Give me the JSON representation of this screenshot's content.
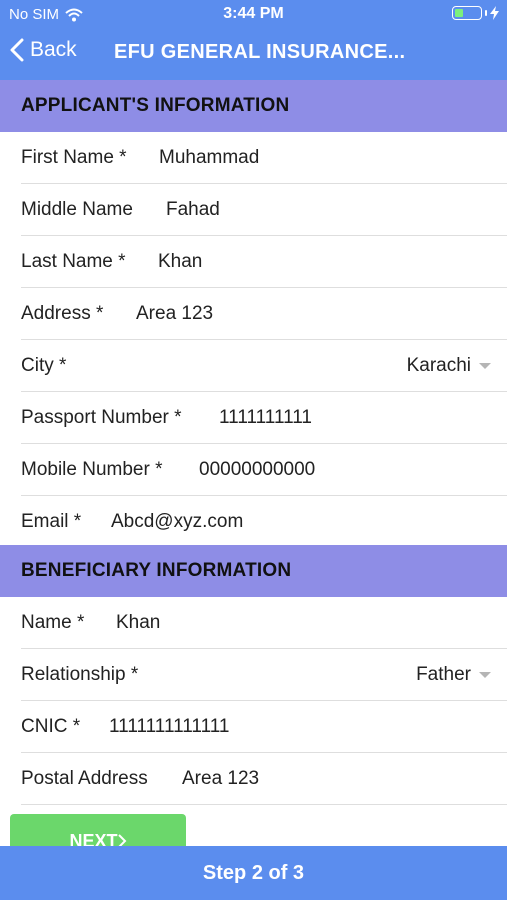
{
  "status_bar": {
    "carrier": "No SIM",
    "time": "3:44 PM"
  },
  "nav": {
    "back_label": "Back",
    "title": "EFU GENERAL INSURANCE..."
  },
  "applicant": {
    "header": "APPLICANT'S INFORMATION",
    "first_name": {
      "label": "First Name *",
      "value": "Muhammad"
    },
    "middle_name": {
      "label": "Middle Name",
      "value": "Fahad"
    },
    "last_name": {
      "label": "Last Name *",
      "value": "Khan"
    },
    "address": {
      "label": "Address *",
      "value": "Area 123"
    },
    "city": {
      "label": "City *",
      "value": "Karachi"
    },
    "passport": {
      "label": "Passport Number *",
      "value": "1111111111"
    },
    "mobile": {
      "label": "Mobile Number *",
      "value": "00000000000"
    },
    "email": {
      "label": "Email *",
      "value": "Abcd@xyz.com"
    }
  },
  "beneficiary": {
    "header": "BENEFICIARY INFORMATION",
    "name": {
      "label": "Name *",
      "value": "Khan"
    },
    "relationship": {
      "label": "Relationship *",
      "value": "Father"
    },
    "cnic": {
      "label": "CNIC *",
      "value": "1111111111111"
    },
    "postal_address": {
      "label": "Postal Address",
      "value": "Area 123"
    }
  },
  "footer": {
    "next_label": "NEXT",
    "step_text": "Step 2 of 3"
  },
  "colors": {
    "bar": "#5b8dee",
    "section": "#8e8de6",
    "next_button": "#6bd76b"
  },
  "icons": [
    "wifi-icon",
    "battery-icon",
    "charging-bolt-icon",
    "back-chevron-icon",
    "dropdown-caret-icon",
    "next-chevron-icon"
  ]
}
